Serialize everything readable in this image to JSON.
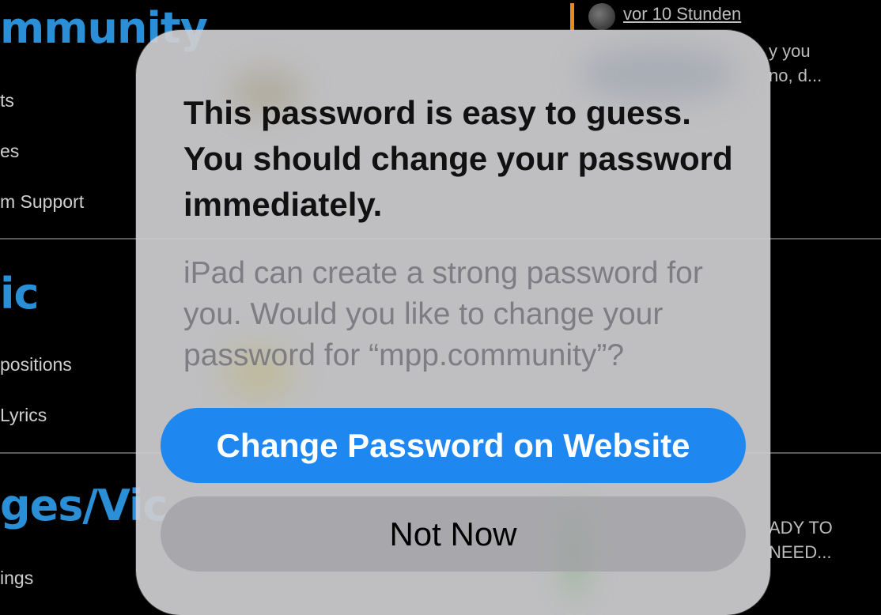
{
  "background": {
    "categories": [
      {
        "title": "mmunity",
        "links": [
          "ts",
          "es",
          "m Support"
        ]
      },
      {
        "title": "ic",
        "links": [
          "positions",
          " Lyrics"
        ]
      },
      {
        "title": "ges/Vic",
        "links": [
          "ings"
        ]
      }
    ],
    "latest_post": {
      "timestamp": "vor 10 Stunden",
      "snippet_1": [
        "y you",
        "no, d..."
      ],
      "snippet_2": [
        "ADY TO",
        "NEED..."
      ]
    }
  },
  "dialog": {
    "title": "This password is easy to guess. You should change your password immediately.",
    "message": "iPad can create a strong password for you. Would you like to change your password for “mpp.community”?",
    "primary_button": "Change Password on Website",
    "secondary_button": "Not Now"
  },
  "colors": {
    "accent_blue": "#1e87f0",
    "category_blue": "#2a8fd6",
    "orange_marker": "#e58a21"
  }
}
